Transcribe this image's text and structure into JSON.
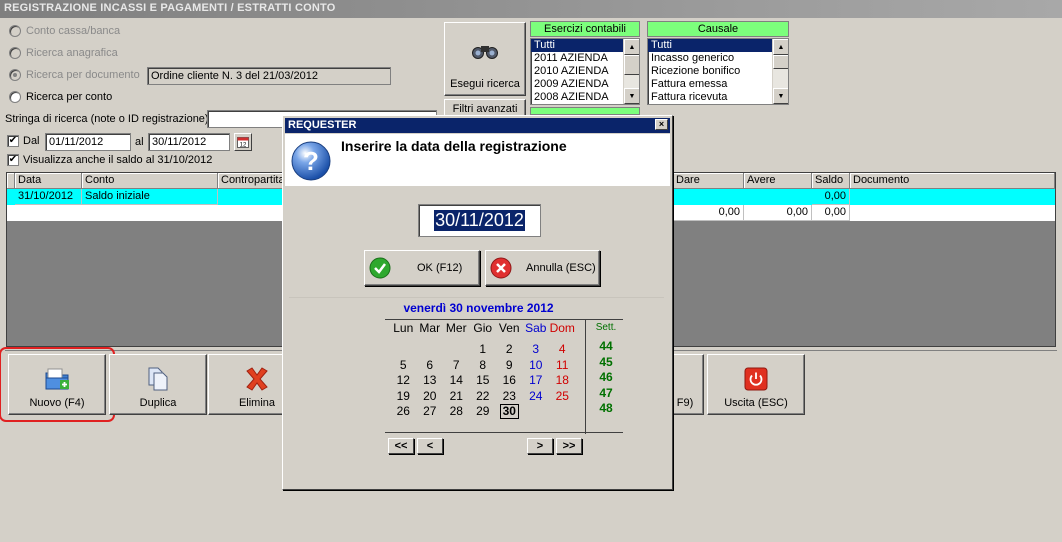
{
  "window": {
    "title": "REGISTRAZIONE INCASSI E PAGAMENTI / ESTRATTI CONTO"
  },
  "search": {
    "options": [
      "Conto cassa/banca",
      "Ricerca anagrafica",
      "Ricerca per documento",
      "Ricerca per conto"
    ],
    "doc_value": "Ordine cliente N. 3 del 21/03/2012",
    "string_label": "Stringa di ricerca (note o ID registrazione)",
    "string_value": "",
    "from_label": "Dal",
    "from_value": "01/11/2012",
    "to_label": "al",
    "to_value": "30/11/2012",
    "balance_label": "Visualizza anche il saldo al 31/10/2012",
    "run_button": "Esegui ricerca",
    "filters_button": "Filtri avanzati"
  },
  "esercizi": {
    "header": "Esercizi contabili",
    "items": [
      "Tutti",
      "2011 AZIENDA",
      "2010 AZIENDA",
      "2009 AZIENDA",
      "2008 AZIENDA"
    ]
  },
  "causale": {
    "header": "Causale",
    "items": [
      "Tutti",
      "Incasso generico",
      "Ricezione bonifico",
      "Fattura emessa",
      "Fattura ricevuta"
    ]
  },
  "table": {
    "headers": [
      "Data",
      "Conto",
      "Contropartita",
      "Dare",
      "Avere",
      "Saldo",
      "Documento"
    ],
    "row1": {
      "data": "31/10/2012",
      "conto": "Saldo iniziale",
      "saldo": "0,00"
    },
    "totals": {
      "dare": "0,00",
      "avere": "0,00",
      "saldo": "0,00"
    }
  },
  "toolbar": {
    "new": "Nuovo (F4)",
    "dup": "Duplica",
    "del": "Elimina",
    "partial": "F9)",
    "exit": "Uscita (ESC)"
  },
  "dialog": {
    "title": "REQUESTER",
    "prompt": "Inserire la data della registrazione",
    "date_value": "30/11/2012",
    "ok": "OK (F12)",
    "cancel": "Annulla (ESC)",
    "cal_title": "venerdì 30 novembre 2012",
    "weekdays": [
      "Lun",
      "Mar",
      "Mer",
      "Gio",
      "Ven",
      "Sab",
      "Dom"
    ],
    "week_label": "Sett.",
    "weeks": [
      "44",
      "45",
      "46",
      "47",
      "48"
    ],
    "days": [
      [
        "",
        "",
        "",
        "1",
        "2",
        "3",
        "4"
      ],
      [
        "5",
        "6",
        "7",
        "8",
        "9",
        "10",
        "11"
      ],
      [
        "12",
        "13",
        "14",
        "15",
        "16",
        "17",
        "18"
      ],
      [
        "19",
        "20",
        "21",
        "22",
        "23",
        "24",
        "25"
      ],
      [
        "26",
        "27",
        "28",
        "29",
        "30",
        "",
        ""
      ]
    ],
    "nav": [
      "<<",
      "<",
      ">",
      ">>"
    ]
  },
  "colors": {
    "accent": "#0a246a",
    "list_header": "#7cff7c",
    "row_highlight": "#00ffff",
    "annotation": "#e02020"
  }
}
